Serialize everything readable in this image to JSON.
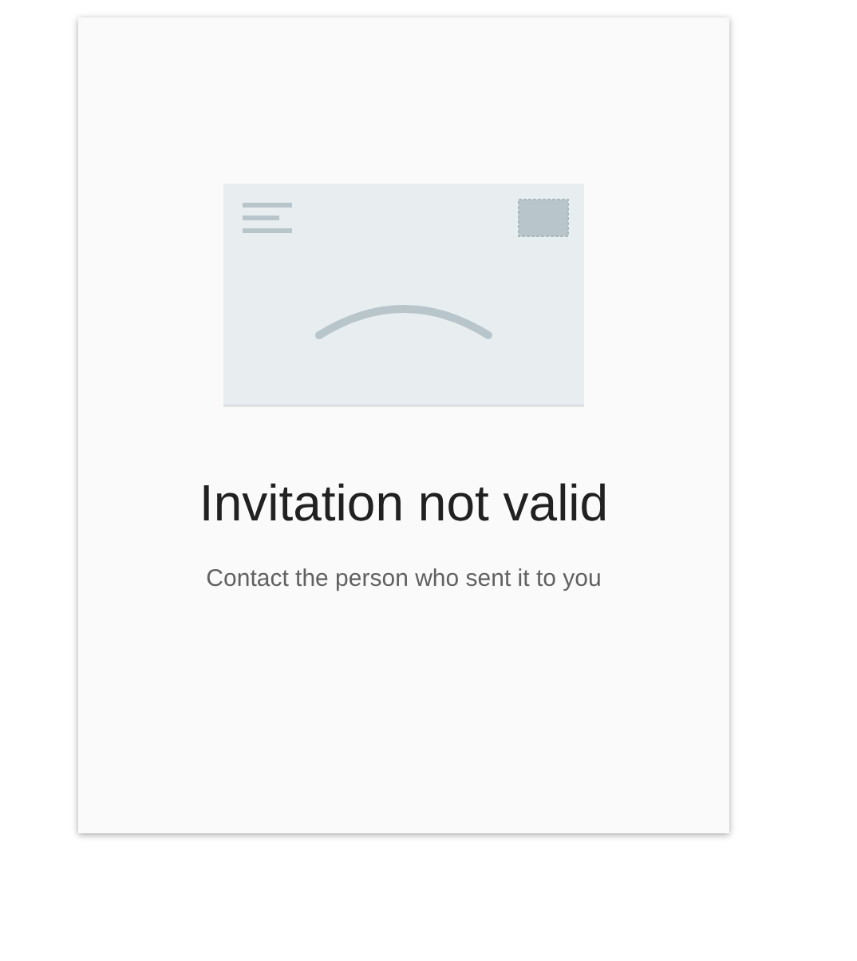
{
  "title": "Invitation not valid",
  "message": "Contact the person who sent it to you"
}
